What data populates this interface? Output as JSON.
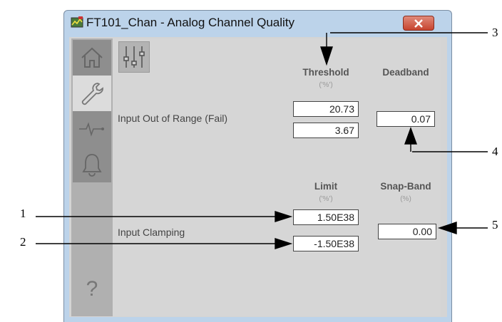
{
  "window": {
    "title": "FT101_Chan - Analog Channel Quality"
  },
  "nav": {
    "icons": [
      "home-icon",
      "wrench-icon",
      "trend-icon",
      "bell-icon",
      "help-icon"
    ],
    "help_label": "?"
  },
  "threshold_section": {
    "threshold_header": "Threshold",
    "threshold_unit": "('%')",
    "deadband_header": "Deadband",
    "row_label": "Input Out of Range (Fail)",
    "high_threshold": "20.73",
    "low_threshold": "3.67",
    "deadband": "0.07"
  },
  "clamping_section": {
    "limit_header": "Limit",
    "limit_unit": "('%')",
    "snapband_header": "Snap-Band",
    "snapband_unit": "(%)",
    "row_label": "Input Clamping",
    "high_limit": "1.50E38",
    "low_limit": "-1.50E38",
    "snap_band": "0.00"
  },
  "callouts": [
    "1",
    "2",
    "3",
    "4",
    "5"
  ]
}
